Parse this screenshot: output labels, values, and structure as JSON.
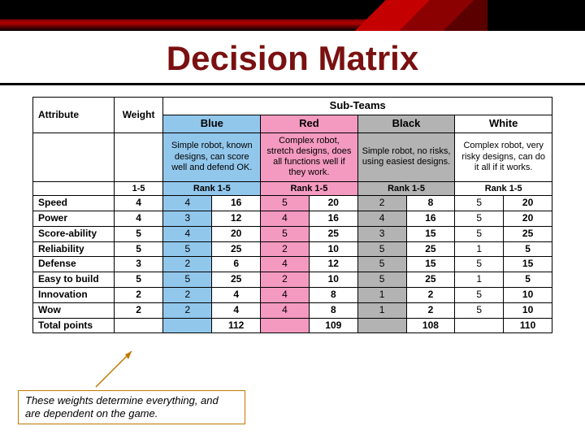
{
  "slide": {
    "title": "Decision Matrix",
    "subheader": "Sub-Teams",
    "attr_label": "Attribute",
    "weight_label": "Weight",
    "weight_range": "1-5",
    "rank_range": "Rank 1-5"
  },
  "teams": [
    {
      "name": "Blue",
      "desc": "Simple robot, known designs, can score well and defend OK."
    },
    {
      "name": "Red",
      "desc": "Complex robot, stretch designs, does all functions well if they work."
    },
    {
      "name": "Black",
      "desc": "Simple robot, no risks, using easiest designs."
    },
    {
      "name": "White",
      "desc": "Complex robot, very risky designs, can do it all if it works."
    }
  ],
  "rows": [
    {
      "attr": "Speed",
      "wt": 4,
      "r": [
        4,
        5,
        2,
        5
      ],
      "s": [
        16,
        20,
        8,
        20
      ]
    },
    {
      "attr": "Power",
      "wt": 4,
      "r": [
        3,
        4,
        4,
        5
      ],
      "s": [
        12,
        16,
        16,
        20
      ]
    },
    {
      "attr": "Score-ability",
      "wt": 5,
      "r": [
        4,
        5,
        3,
        5
      ],
      "s": [
        20,
        25,
        15,
        25
      ]
    },
    {
      "attr": "Reliability",
      "wt": 5,
      "r": [
        5,
        2,
        5,
        1
      ],
      "s": [
        25,
        10,
        25,
        5
      ]
    },
    {
      "attr": "Defense",
      "wt": 3,
      "r": [
        2,
        4,
        5,
        5
      ],
      "s": [
        6,
        12,
        15,
        15
      ]
    },
    {
      "attr": "Easy to build",
      "wt": 5,
      "r": [
        5,
        2,
        5,
        1
      ],
      "s": [
        25,
        10,
        25,
        5
      ]
    },
    {
      "attr": "Innovation",
      "wt": 2,
      "r": [
        2,
        4,
        1,
        5
      ],
      "s": [
        4,
        8,
        2,
        10
      ]
    },
    {
      "attr": "Wow",
      "wt": 2,
      "r": [
        2,
        4,
        1,
        5
      ],
      "s": [
        4,
        8,
        2,
        10
      ]
    }
  ],
  "totals": {
    "label": "Total points",
    "s": [
      112,
      109,
      108,
      110
    ]
  },
  "callout": {
    "line1": "These weights determine everything, and",
    "line2": "are dependent on the game."
  },
  "colors": {
    "blue": "#92c7ec",
    "red": "#f49ac0",
    "black": "#b3b3b3",
    "white": "#ffffff"
  },
  "chart_data": {
    "type": "table",
    "title": "Decision Matrix",
    "group_header": "Sub-Teams",
    "row_headers": [
      "Speed",
      "Power",
      "Score-ability",
      "Reliability",
      "Defense",
      "Easy to build",
      "Innovation",
      "Wow"
    ],
    "weights": [
      4,
      4,
      5,
      5,
      3,
      5,
      2,
      2
    ],
    "columns": [
      "Blue",
      "Red",
      "Black",
      "White"
    ],
    "column_descriptions": [
      "Simple robot, known designs, can score well and defend OK.",
      "Complex robot, stretch designs, does all functions well if they work.",
      "Simple robot, no risks, using easiest designs.",
      "Complex robot, very risky designs, can do it all if it works."
    ],
    "ranks": [
      [
        4,
        5,
        2,
        5
      ],
      [
        3,
        4,
        4,
        5
      ],
      [
        4,
        5,
        3,
        5
      ],
      [
        5,
        2,
        5,
        1
      ],
      [
        2,
        4,
        5,
        5
      ],
      [
        5,
        2,
        5,
        1
      ],
      [
        2,
        4,
        1,
        5
      ],
      [
        2,
        4,
        1,
        5
      ]
    ],
    "scores": [
      [
        16,
        20,
        8,
        20
      ],
      [
        12,
        16,
        16,
        20
      ],
      [
        20,
        25,
        15,
        25
      ],
      [
        25,
        10,
        25,
        5
      ],
      [
        6,
        12,
        15,
        15
      ],
      [
        25,
        10,
        25,
        5
      ],
      [
        4,
        8,
        2,
        10
      ],
      [
        4,
        8,
        2,
        10
      ]
    ],
    "totals": [
      112,
      109,
      108,
      110
    ],
    "rank_scale": "1-5",
    "weight_scale": "1-5",
    "annotation": "These weights determine everything, and are dependent on the game."
  }
}
